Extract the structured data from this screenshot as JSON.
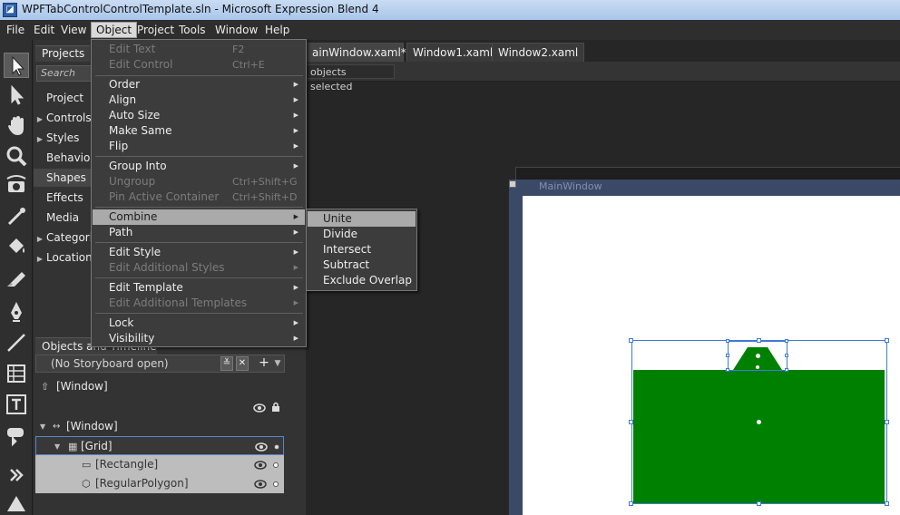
{
  "window": {
    "title": "WPFTabControlControlTemplate.sln - Microsoft Expression Blend 4",
    "app_icon": "expression-blend-icon"
  },
  "menubar": {
    "items": [
      "File",
      "Edit",
      "View",
      "Object",
      "Project",
      "Tools",
      "Window",
      "Help"
    ],
    "active": "Object"
  },
  "toolbox": {
    "tools": [
      "selection-arrow-icon",
      "direct-selection-icon",
      "pan-hand-icon",
      "zoom-icon",
      "camera-orbit-icon",
      "eyedropper-icon",
      "paint-bucket-icon",
      "gradient-tool-icon",
      "pen-icon",
      "line-icon",
      "grid-layout-icon",
      "text-tool-icon",
      "asset-tool-icon",
      "expand-toolbox-icon",
      "shapes-triangle-icon"
    ]
  },
  "projects_panel": {
    "tab": "Projects",
    "search_placeholder": "Search",
    "items": [
      {
        "label": "Project",
        "expandable": false
      },
      {
        "label": "Controls",
        "expandable": true
      },
      {
        "label": "Styles",
        "expandable": true
      },
      {
        "label": "Behaviors",
        "expandable": false
      },
      {
        "label": "Shapes",
        "expandable": false
      },
      {
        "label": "Effects",
        "expandable": false
      },
      {
        "label": "Media",
        "expandable": false
      },
      {
        "label": "Categories",
        "expandable": true
      },
      {
        "label": "Locations",
        "expandable": true
      }
    ],
    "active": "Shapes"
  },
  "object_menu": {
    "items": [
      {
        "label": "Edit Text",
        "shortcut": "F2",
        "disabled": true,
        "submenu": false
      },
      {
        "label": "Edit Control",
        "shortcut": "Ctrl+E",
        "disabled": true,
        "submenu": false
      },
      {
        "label": "Order",
        "shortcut": "",
        "disabled": false,
        "submenu": true
      },
      {
        "label": "Align",
        "shortcut": "",
        "disabled": false,
        "submenu": true
      },
      {
        "label": "Auto Size",
        "shortcut": "",
        "disabled": false,
        "submenu": true
      },
      {
        "label": "Make Same",
        "shortcut": "",
        "disabled": false,
        "submenu": true
      },
      {
        "label": "Flip",
        "shortcut": "",
        "disabled": false,
        "submenu": true
      },
      {
        "label": "Group Into",
        "shortcut": "",
        "disabled": false,
        "submenu": true
      },
      {
        "label": "Ungroup",
        "shortcut": "Ctrl+Shift+G",
        "disabled": true,
        "submenu": false
      },
      {
        "label": "Pin Active Container",
        "shortcut": "Ctrl+Shift+D",
        "disabled": true,
        "submenu": false
      },
      {
        "label": "Combine",
        "shortcut": "",
        "disabled": false,
        "submenu": true
      },
      {
        "label": "Path",
        "shortcut": "",
        "disabled": false,
        "submenu": true
      },
      {
        "label": "Edit Style",
        "shortcut": "",
        "disabled": false,
        "submenu": true
      },
      {
        "label": "Edit Additional Styles",
        "shortcut": "",
        "disabled": true,
        "submenu": true
      },
      {
        "label": "Edit Template",
        "shortcut": "",
        "disabled": false,
        "submenu": true
      },
      {
        "label": "Edit Additional Templates",
        "shortcut": "",
        "disabled": true,
        "submenu": true
      },
      {
        "label": "Lock",
        "shortcut": "",
        "disabled": false,
        "submenu": true
      },
      {
        "label": "Visibility",
        "shortcut": "",
        "disabled": false,
        "submenu": true
      }
    ],
    "highlighted": "Combine"
  },
  "combine_submenu": {
    "items": [
      "Unite",
      "Divide",
      "Intersect",
      "Subtract",
      "Exclude Overlap"
    ],
    "highlighted": "Unite"
  },
  "document": {
    "tabs": [
      {
        "label": "ainWindow.xaml*",
        "closable": true,
        "active": true
      },
      {
        "label": "Window1.xaml",
        "closable": false,
        "active": false
      },
      {
        "label": "Window2.xaml",
        "closable": false,
        "active": false
      }
    ],
    "close_glyph": "×",
    "status": "objects selected"
  },
  "artboard": {
    "window_title": "MainWindow",
    "colors": {
      "shape_fill": "#008000",
      "selection": "#3f7bd6",
      "window_frame": "#3a4a66"
    }
  },
  "objects_panel": {
    "tab": "Objects and Timeline",
    "storyboard": "(No Storyboard open)",
    "add_glyph": "+",
    "tree": [
      {
        "label": "[Window]",
        "icon": "scope-up-icon",
        "indent": 0,
        "expandable": false
      },
      {
        "label": "[Window]",
        "icon": "window-element-icon",
        "indent": 0,
        "expandable": true
      },
      {
        "label": "[Grid]",
        "icon": "grid-element-icon",
        "indent": 1,
        "expandable": true
      },
      {
        "label": "[Rectangle]",
        "icon": "rectangle-element-icon",
        "indent": 2,
        "expandable": false
      },
      {
        "label": "[RegularPolygon]",
        "icon": "polygon-element-icon",
        "indent": 2,
        "expandable": false
      }
    ]
  }
}
